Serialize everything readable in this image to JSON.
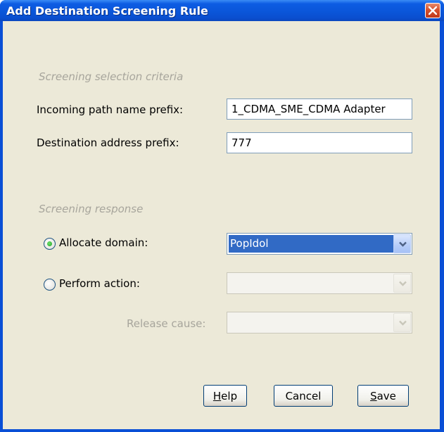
{
  "window": {
    "title": "Add Destination Screening Rule"
  },
  "criteria": {
    "heading": "Screening selection criteria",
    "incoming_label": "Incoming path name prefix:",
    "incoming_value": "1_CDMA_SME_CDMA Adapter",
    "destination_label": "Destination address prefix:",
    "destination_value": "777"
  },
  "response": {
    "heading": "Screening response",
    "allocate_label": "Allocate domain:",
    "allocate_selected": true,
    "allocate_value": "PopIdol",
    "perform_label": "Perform action:",
    "perform_selected": false,
    "perform_value": "",
    "release_label": "Release cause:",
    "release_value": ""
  },
  "buttons": {
    "help": "Help",
    "help_mnemonic": "H",
    "help_rest": "elp",
    "cancel": "Cancel",
    "save": "Save",
    "save_mnemonic": "S",
    "save_rest": "ave"
  },
  "colors": {
    "title_bar": "#0a55d8",
    "dialog_bg": "#ece9d8",
    "selection": "#316ac5",
    "close_button": "#d6512d"
  },
  "icons": [
    "close-icon",
    "chevron-down-icon"
  ]
}
